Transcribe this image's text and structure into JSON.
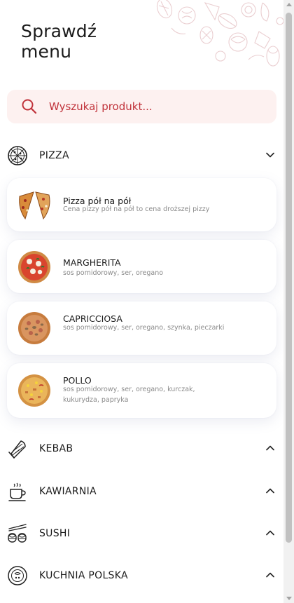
{
  "header": {
    "title_line1": "Sprawdź",
    "title_line2": "menu"
  },
  "search": {
    "placeholder": "Wyszukaj produkt...",
    "icon": "search-icon",
    "accent": "#c0323a",
    "background": "#fdf1f0"
  },
  "categories": [
    {
      "label": "PIZZA",
      "icon": "pizza-icon",
      "state": "expanded"
    },
    {
      "label": "KEBAB",
      "icon": "kebab-icon",
      "state": "collapsed"
    },
    {
      "label": "KAWIARNIA",
      "icon": "coffee-icon",
      "state": "collapsed"
    },
    {
      "label": "SUSHI",
      "icon": "sushi-icon",
      "state": "collapsed"
    },
    {
      "label": "KUCHNIA POLSKA",
      "icon": "plate-icon",
      "state": "collapsed"
    }
  ],
  "pizza_items": [
    {
      "name": "Pizza pół na pół",
      "description": "Cena pizzy pół na pół to cena droższej pizzy"
    },
    {
      "name": "MARGHERITA",
      "description": "sos pomidorowy, ser, oregano"
    },
    {
      "name": "CAPRICCIOSA",
      "description": "sos pomidorowy, ser, oregano, szynka, pieczarki"
    },
    {
      "name": "POLLO",
      "description": "sos pomidorowy, ser, oregano, kurczak, kukurydza, papryka"
    }
  ]
}
